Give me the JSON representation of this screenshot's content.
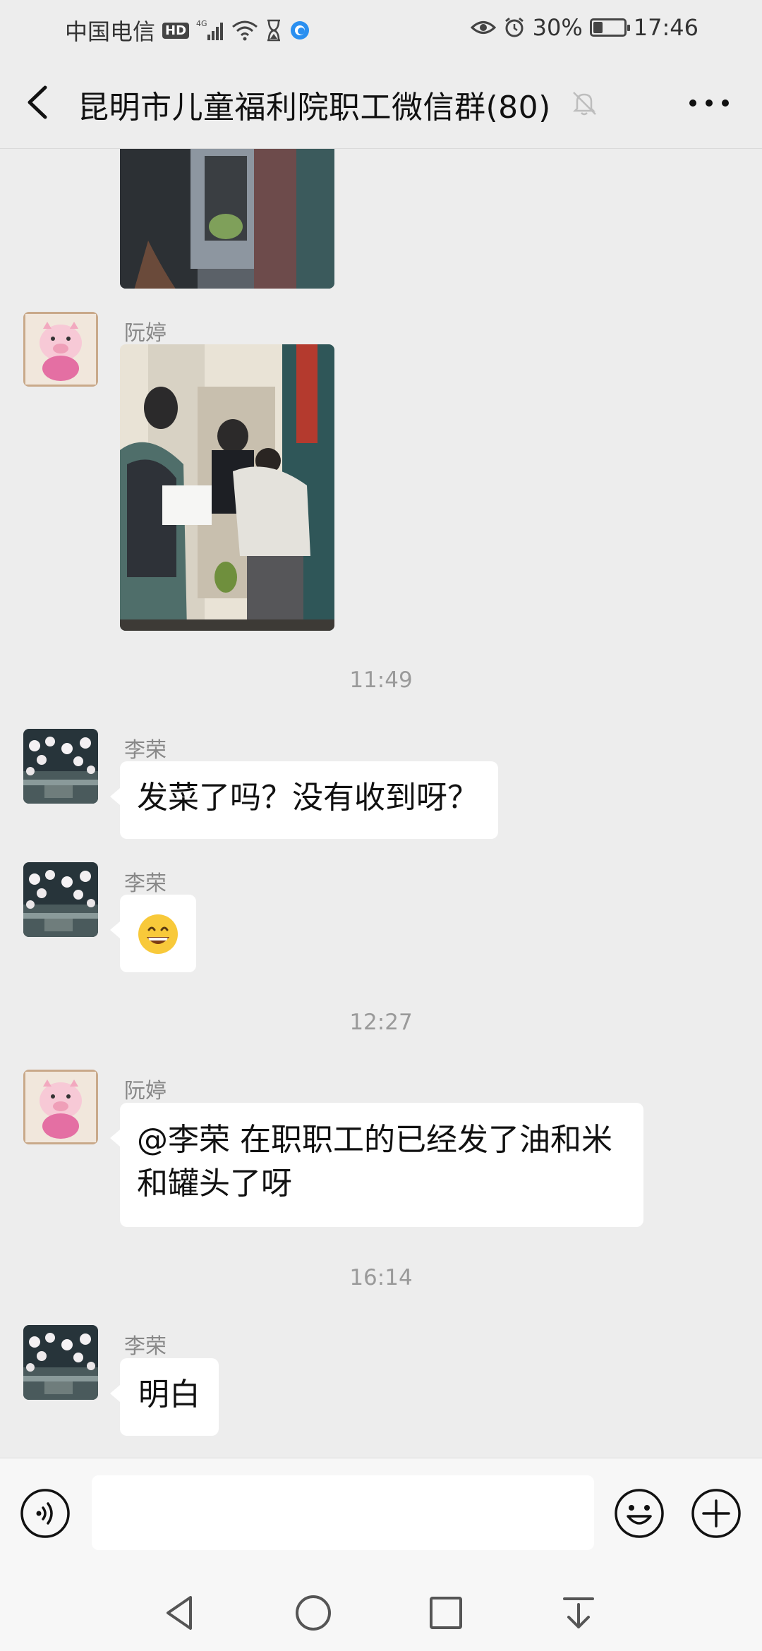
{
  "status_bar": {
    "carrier": "中国电信",
    "hd": "HD",
    "network": "4G",
    "battery": "30%",
    "battery_level": 0.3,
    "time": "17:46"
  },
  "header": {
    "title": "昆明市儿童福利院职工微信群(80)",
    "icons": [
      "back-arrow-icon",
      "mute-bell-icon",
      "more-icon"
    ]
  },
  "messages": [
    {
      "type": "image",
      "sender": "",
      "description_icon": "photo"
    },
    {
      "type": "image",
      "sender": "阮婷",
      "description_icon": "photo"
    },
    {
      "type": "time",
      "text": "11:49"
    },
    {
      "type": "text",
      "sender": "李荣",
      "text": "发菜了吗？没有收到呀？"
    },
    {
      "type": "emoji",
      "sender": "李荣",
      "text": "😄"
    },
    {
      "type": "time",
      "text": "12:27"
    },
    {
      "type": "text",
      "sender": "阮婷",
      "line1": "@李荣  在职职工的已经发了油和米",
      "line2": "和罐头了呀"
    },
    {
      "type": "time",
      "text": "16:14"
    },
    {
      "type": "text",
      "sender": "李荣",
      "text": "明白"
    }
  ],
  "input_bar": {
    "placeholder": "",
    "icons": [
      "voice-icon",
      "emoji-icon",
      "add-icon"
    ]
  },
  "nav": {
    "icons": [
      "back-triangle-icon",
      "home-circle-icon",
      "recents-square-icon",
      "notification-pull-icon"
    ]
  },
  "colors": {
    "background": "#ededed",
    "bubble": "#ffffff",
    "timestamp": "#9a9a9a"
  }
}
